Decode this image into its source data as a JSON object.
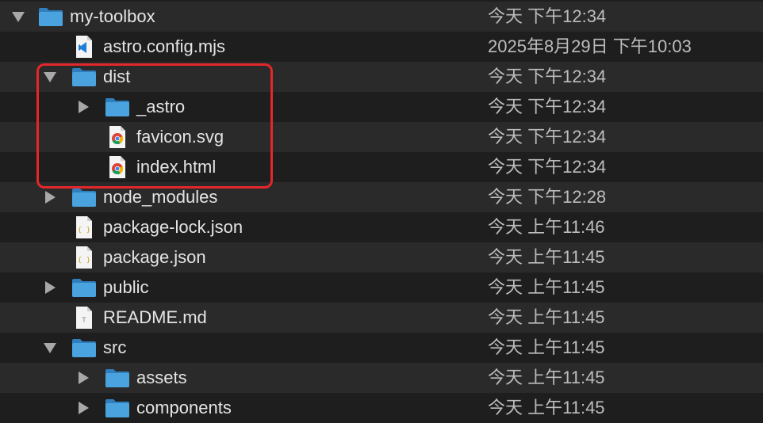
{
  "rows": [
    {
      "name": "my-toolbox",
      "date": "今天 下午12:34",
      "icon": "folder-icon",
      "disclosure": "expanded"
    },
    {
      "name": "astro.config.mjs",
      "date": "2025年8月29日 下午10:03",
      "icon": "vscode-file-icon",
      "disclosure": "none"
    },
    {
      "name": "dist",
      "date": "今天 下午12:34",
      "icon": "folder-icon",
      "disclosure": "expanded"
    },
    {
      "name": "_astro",
      "date": "今天 下午12:34",
      "icon": "folder-icon",
      "disclosure": "collapsed"
    },
    {
      "name": "favicon.svg",
      "date": "今天 下午12:34",
      "icon": "chrome-file-icon",
      "disclosure": "none"
    },
    {
      "name": "index.html",
      "date": "今天 下午12:34",
      "icon": "chrome-file-icon",
      "disclosure": "none"
    },
    {
      "name": "node_modules",
      "date": "今天 下午12:28",
      "icon": "folder-icon",
      "disclosure": "collapsed"
    },
    {
      "name": "package-lock.json",
      "date": "今天 上午11:46",
      "icon": "json-file-icon",
      "disclosure": "none"
    },
    {
      "name": "package.json",
      "date": "今天 上午11:45",
      "icon": "json-file-icon",
      "disclosure": "none"
    },
    {
      "name": "public",
      "date": "今天 上午11:45",
      "icon": "folder-icon",
      "disclosure": "collapsed"
    },
    {
      "name": "README.md",
      "date": "今天 上午11:45",
      "icon": "text-file-icon",
      "disclosure": "none"
    },
    {
      "name": "src",
      "date": "今天 上午11:45",
      "icon": "folder-icon",
      "disclosure": "expanded"
    },
    {
      "name": "assets",
      "date": "今天 上午11:45",
      "icon": "folder-icon",
      "disclosure": "collapsed"
    },
    {
      "name": "components",
      "date": "今天 上午11:45",
      "icon": "folder-icon",
      "disclosure": "collapsed"
    }
  ],
  "colors": {
    "row_alt": "#2a2a2a",
    "row_base": "#1e1e1e",
    "folder": "#4aa3df",
    "highlight": "#e3272b"
  }
}
